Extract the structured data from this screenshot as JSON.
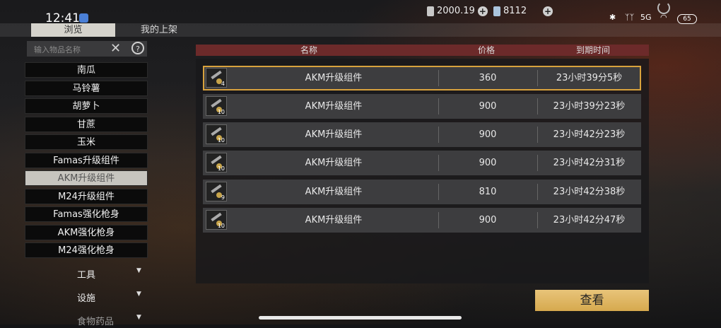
{
  "status": {
    "time": "12:41",
    "currency1": "2000.19",
    "currency2": "8112",
    "battery": "65",
    "network_label": "5G"
  },
  "tabs": [
    {
      "label": "浏览"
    },
    {
      "label": "我的上架"
    }
  ],
  "search": {
    "placeholder": "输入物品名称",
    "help": "?"
  },
  "categories": [
    {
      "label": "南瓜"
    },
    {
      "label": "马铃薯"
    },
    {
      "label": "胡萝卜"
    },
    {
      "label": "甘蔗"
    },
    {
      "label": "玉米"
    },
    {
      "label": "Famas升级组件"
    },
    {
      "label": "AKM升级组件"
    },
    {
      "label": "M24升级组件"
    },
    {
      "label": "Famas强化枪身"
    },
    {
      "label": "AKM强化枪身"
    },
    {
      "label": "M24强化枪身"
    }
  ],
  "groups": [
    {
      "label": "工具"
    },
    {
      "label": "设施"
    },
    {
      "label": "食物药品"
    }
  ],
  "table": {
    "columns": [
      "名称",
      "价格",
      "到期时间"
    ],
    "rows": [
      {
        "qty": "4",
        "name": "AKM升级组件",
        "price": "360",
        "expires": "23小时39分5秒"
      },
      {
        "qty": "10",
        "name": "AKM升级组件",
        "price": "900",
        "expires": "23小时39分23秒"
      },
      {
        "qty": "10",
        "name": "AKM升级组件",
        "price": "900",
        "expires": "23小时42分23秒"
      },
      {
        "qty": "10",
        "name": "AKM升级组件",
        "price": "900",
        "expires": "23小时42分31秒"
      },
      {
        "qty": "9",
        "name": "AKM升级组件",
        "price": "810",
        "expires": "23小时42分38秒"
      },
      {
        "qty": "10",
        "name": "AKM升级组件",
        "price": "900",
        "expires": "23小时42分47秒"
      }
    ]
  },
  "view_button": "查看",
  "colors": {
    "accent": "#d8a23d",
    "header": "#6c2a2a",
    "button": "#e2b865"
  }
}
